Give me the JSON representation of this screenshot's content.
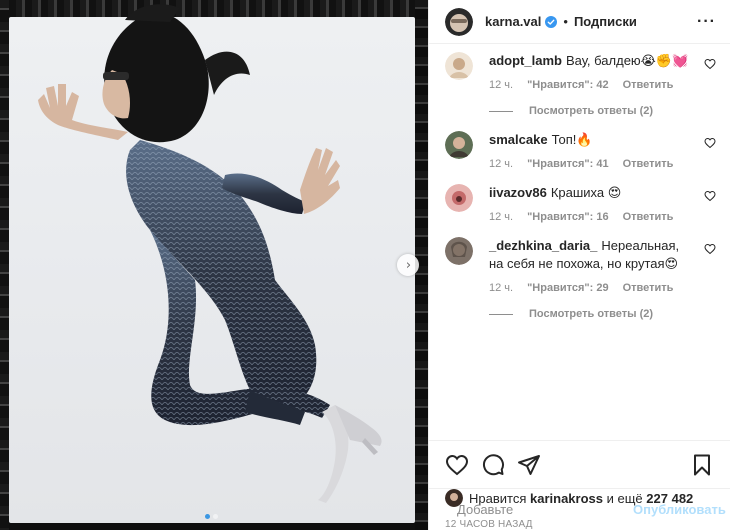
{
  "header": {
    "username": "karna.val",
    "separator": "•",
    "follow_label": "Подписки",
    "more_label": "···"
  },
  "media": {
    "next_arrow_glyph": "›",
    "slide_count": 2,
    "active_slide": 1
  },
  "comments": [
    {
      "username": "adopt_lamb",
      "text": "Вау, балдею😭✊💓",
      "time": "12 ч.",
      "likes": "\"Нравится\": 42",
      "reply_label": "Ответить",
      "view_replies": "Посмотреть ответы (2)",
      "avatar_color": "#e8d7c4"
    },
    {
      "username": "smalcake",
      "text": "Топ!🔥",
      "time": "12 ч.",
      "likes": "\"Нравится\": 41",
      "reply_label": "Ответить",
      "view_replies": "",
      "avatar_color": "#6a7a5c"
    },
    {
      "username": "iivazov86",
      "text": "Крашиха 😍",
      "time": "12 ч.",
      "likes": "\"Нравится\": 16",
      "reply_label": "Ответить",
      "view_replies": "",
      "avatar_color": "#d98c8c"
    },
    {
      "username": "_dezhkina_daria_",
      "text": "Нереальная, на себя не похожа, но крутая😍",
      "time": "12 ч.",
      "likes": "\"Нравится\": 29",
      "reply_label": "Ответить",
      "view_replies": "Посмотреть ответы (2)",
      "avatar_color": "#8a7d72"
    }
  ],
  "actions": {
    "liked_prefix": "Нравится",
    "liked_user": "karinakross",
    "liked_suffix": "и ещё",
    "liked_count": "227 482",
    "timestamp": "12 ЧАСОВ НАЗАД"
  },
  "add_comment": {
    "placeholder": "Добавьте",
    "publish_label": "Опубликовать"
  },
  "colors": {
    "verified": "#3897f0",
    "link_disabled": "#b2dffc",
    "muted": "#8e8e8e",
    "text": "#262626"
  },
  "icons": [
    "verified-icon",
    "heart-icon",
    "comment-icon",
    "share-icon",
    "bookmark-icon",
    "smile-icon",
    "chevron-right-icon"
  ]
}
